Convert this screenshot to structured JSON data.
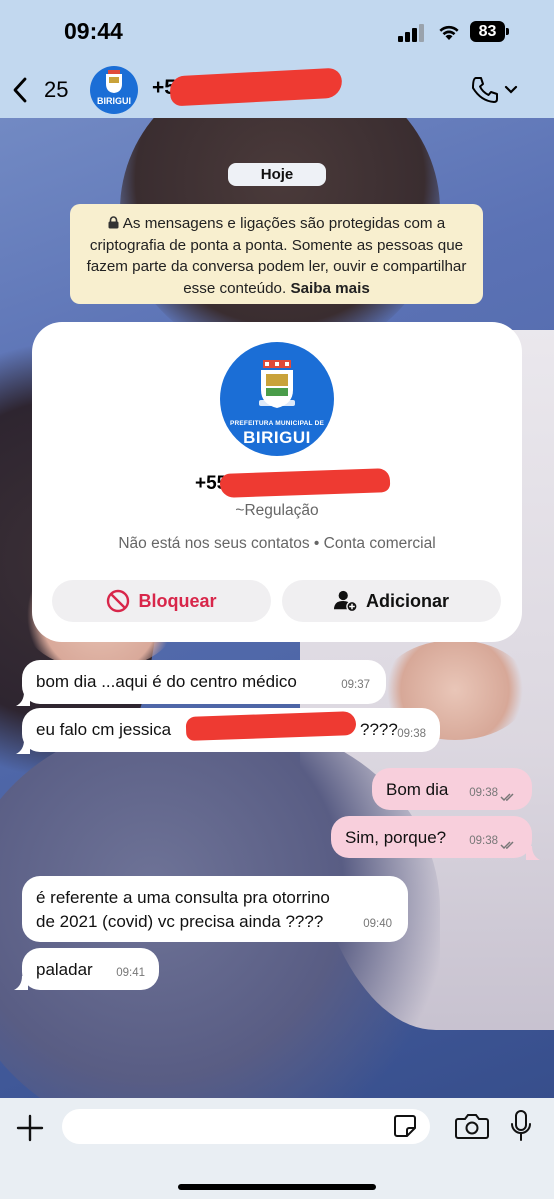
{
  "status_bar": {
    "time": "09:44",
    "battery": "83"
  },
  "header": {
    "back_count": "25",
    "contact_name": "+5",
    "avatar_icon": "birigui-logo",
    "call_icon": "phone-chevron-icon"
  },
  "day_label": "Hoje",
  "encryption": {
    "text": "As mensagens e ligações são protegidas com a criptografia de ponta a ponta. Somente as pessoas que fazem parte da conversa podem ler, ouvir e compartilhar esse conteúdo.",
    "link": "Saiba mais"
  },
  "contact_card": {
    "logo_top": "PREFEITURA MUNICIPAL DE",
    "logo_main": "BIRIGUI",
    "phone": "+55",
    "subname": "~Regulação",
    "meta": "Não está nos seus contatos • Conta comercial",
    "block_label": "Bloquear",
    "add_label": "Adicionar"
  },
  "messages": [
    {
      "direction": "in",
      "text": "bom dia ...aqui é do centro médico",
      "time": "09:37"
    },
    {
      "direction": "in",
      "text": "eu falo cm jessica",
      "text_tail": "????",
      "time": "09:38"
    },
    {
      "direction": "out",
      "text": "Bom dia",
      "time": "09:38"
    },
    {
      "direction": "out",
      "text": "Sim, porque?",
      "time": "09:38"
    },
    {
      "direction": "in",
      "text": "é referente a uma consulta pra otorrino de 2021 (covid) vc precisa ainda ????",
      "time": "09:40"
    },
    {
      "direction": "in",
      "text": "paladar",
      "time": "09:41"
    }
  ],
  "composer": {
    "placeholder": ""
  },
  "colors": {
    "header_bg": "#c2d8ef",
    "outgoing_bubble": "#f8cfdc",
    "incoming_bubble": "#ffffff",
    "notice_bg": "#f8efcf",
    "block_red": "#d8264a",
    "logo_blue": "#1b6ed6"
  }
}
